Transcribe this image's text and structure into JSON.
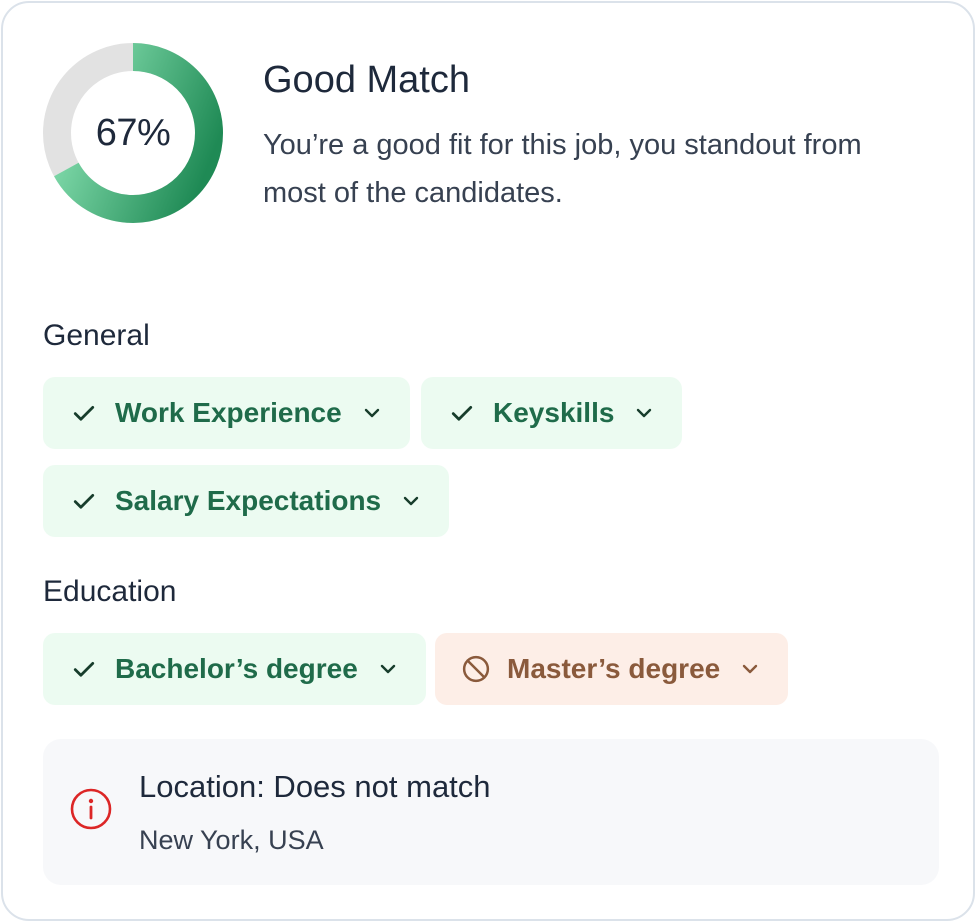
{
  "match": {
    "percent_label": "67%",
    "percent_value": 0.67,
    "title": "Good Match",
    "description": "You’re a good fit for this job, you standout from most of the candidates."
  },
  "sections": {
    "general": {
      "label": "General",
      "chips": [
        {
          "label": "Work Experience",
          "status": "match",
          "icon": "check-icon"
        },
        {
          "label": "Keyskills",
          "status": "match",
          "icon": "check-icon"
        },
        {
          "label": "Salary Expectations",
          "status": "match",
          "icon": "check-icon"
        }
      ]
    },
    "education": {
      "label": "Education",
      "chips": [
        {
          "label": "Bachelor’s degree",
          "status": "match",
          "icon": "check-icon"
        },
        {
          "label": "Master’s degree",
          "status": "no-match",
          "icon": "prohibited-icon"
        }
      ]
    }
  },
  "location": {
    "title": "Location: Does not match",
    "value": "New York, USA",
    "icon": "info-icon"
  },
  "colors": {
    "match_bg": "#ecfbf1",
    "match_text": "#1f6b4a",
    "mismatch_bg": "#fdeee7",
    "mismatch_text": "#8a5a3c",
    "alert": "#dc2626",
    "donut_start": "#1f8a55",
    "donut_end": "#8be3b4",
    "donut_track": "#e2e2e2"
  }
}
